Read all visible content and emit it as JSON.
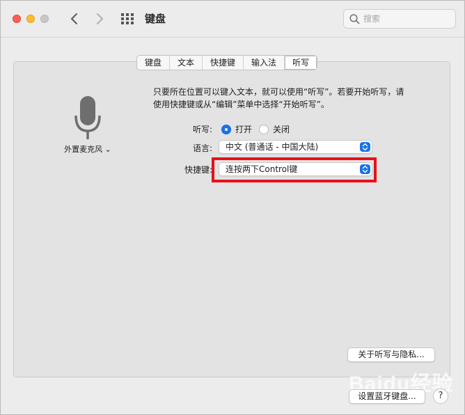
{
  "window": {
    "title": "键盘"
  },
  "search": {
    "placeholder": "搜索"
  },
  "tabs": [
    {
      "label": "键盘"
    },
    {
      "label": "文本"
    },
    {
      "label": "快捷键"
    },
    {
      "label": "输入法"
    },
    {
      "label": "听写",
      "active": true
    }
  ],
  "microphone": {
    "label": "外置麦克风 ⌄"
  },
  "description": "只要所在位置可以键入文本，就可以使用“听写”。若要开始听写，请使用快捷键或从“编辑”菜单中选择“开始听写”。",
  "dictation": {
    "label": "听写:",
    "on_label": "打开",
    "off_label": "关闭",
    "selected": "打开"
  },
  "language": {
    "label": "语言:",
    "value": "中文 (普通话 - 中国大陆)"
  },
  "shortcut": {
    "label": "快捷键:",
    "value": "连按两下Control键"
  },
  "buttons": {
    "privacy": "关于听写与隐私...",
    "bluetooth": "设置蓝牙键盘...",
    "help": "?"
  },
  "watermark": "Baidu经验",
  "colors": {
    "accent": "#1a72e8",
    "highlight_border": "#e8101a",
    "close": "#fe5f57",
    "minimize": "#febc2e",
    "zoom": "#c8c8c8"
  }
}
